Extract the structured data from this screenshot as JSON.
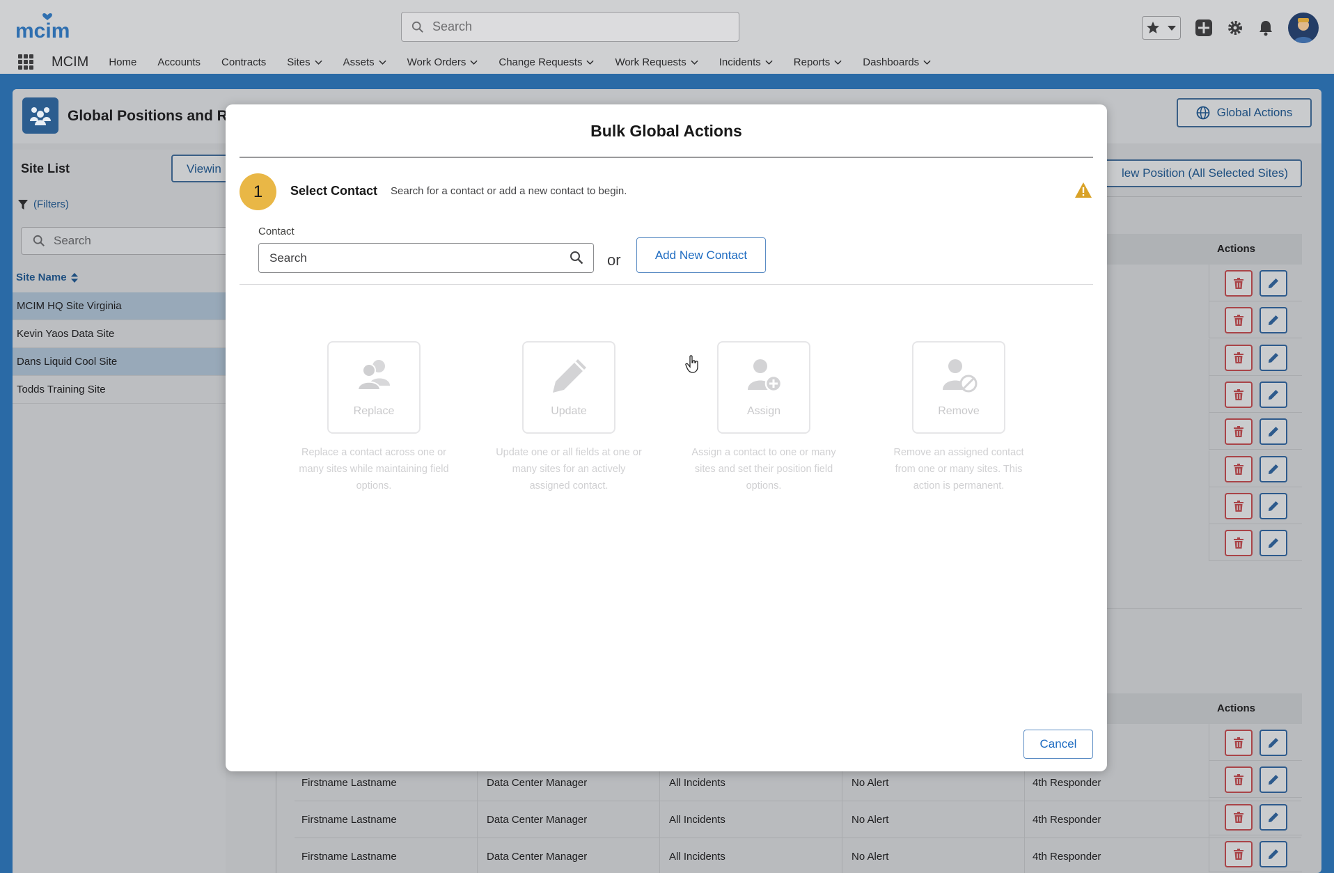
{
  "header": {
    "logo_text": "mcim",
    "search_placeholder": "Search",
    "app_name": "MCIM",
    "nav": [
      {
        "label": "Home",
        "dropdown": false
      },
      {
        "label": "Accounts",
        "dropdown": false
      },
      {
        "label": "Contracts",
        "dropdown": false
      },
      {
        "label": "Sites",
        "dropdown": true
      },
      {
        "label": "Assets",
        "dropdown": true
      },
      {
        "label": "Work Orders",
        "dropdown": true
      },
      {
        "label": "Change Requests",
        "dropdown": true
      },
      {
        "label": "Work Requests",
        "dropdown": true
      },
      {
        "label": "Incidents",
        "dropdown": true
      },
      {
        "label": "Reports",
        "dropdown": true
      },
      {
        "label": "Dashboards",
        "dropdown": true
      }
    ],
    "icons": [
      "star-icon",
      "chevron-down-icon",
      "add-icon",
      "gear-icon",
      "bell-icon",
      "avatar"
    ]
  },
  "page": {
    "title": "Global Positions and Re",
    "global_actions_label": "Global Actions",
    "new_position_label": "lew Position (All Selected Sites)",
    "actions_header": "Actions"
  },
  "site_list": {
    "title": "Site List",
    "viewing_label": "Viewin",
    "filters_label": "(Filters)",
    "search_placeholder": "Search",
    "column_header": "Site Name",
    "rows": [
      {
        "name": "MCIM HQ Site Virginia",
        "selected": true
      },
      {
        "name": "Kevin Yaos Data Site",
        "selected": false
      },
      {
        "name": "Dans Liquid Cool Site",
        "selected": true
      },
      {
        "name": "Todds Training Site",
        "selected": false
      }
    ]
  },
  "bottom_table": {
    "rows": [
      {
        "name": "Firstname Lastname",
        "role": "Data Center Manager",
        "incidents": "All Incidents",
        "alert": "No Alert",
        "responder": "4th Responder"
      },
      {
        "name": "Firstname Lastname",
        "role": "Data Center Manager",
        "incidents": "All Incidents",
        "alert": "No Alert",
        "responder": "4th Responder"
      },
      {
        "name": "Firstname Lastname",
        "role": "Data Center Manager",
        "incidents": "All Incidents",
        "alert": "No Alert",
        "responder": "4th Responder"
      }
    ]
  },
  "modal": {
    "title": "Bulk Global Actions",
    "step_number": "1",
    "step_title": "Select Contact",
    "step_description": "Search for a contact or add a new contact to begin.",
    "contact_label": "Contact",
    "contact_placeholder": "Search",
    "or_text": "or",
    "add_contact_label": "Add New Contact",
    "cancel_label": "Cancel",
    "actions": [
      {
        "label": "Replace",
        "icon": "users-icon",
        "description": "Replace a contact across one or many sites while maintaining field options."
      },
      {
        "label": "Update",
        "icon": "pencil-icon",
        "description": "Update one or all fields at one or many sites for an actively assigned contact."
      },
      {
        "label": "Assign",
        "icon": "user-add-icon",
        "description": "Assign a contact to one or many sites and set their position field options."
      },
      {
        "label": "Remove",
        "icon": "user-remove-icon",
        "description": "Remove an assigned contact from one or many sites. This action is permanent."
      }
    ]
  },
  "colors": {
    "brand_blue": "#1d6bc1",
    "step_badge": "#e9b746",
    "warning": "#d9a227",
    "delete_red": "#a94448"
  }
}
